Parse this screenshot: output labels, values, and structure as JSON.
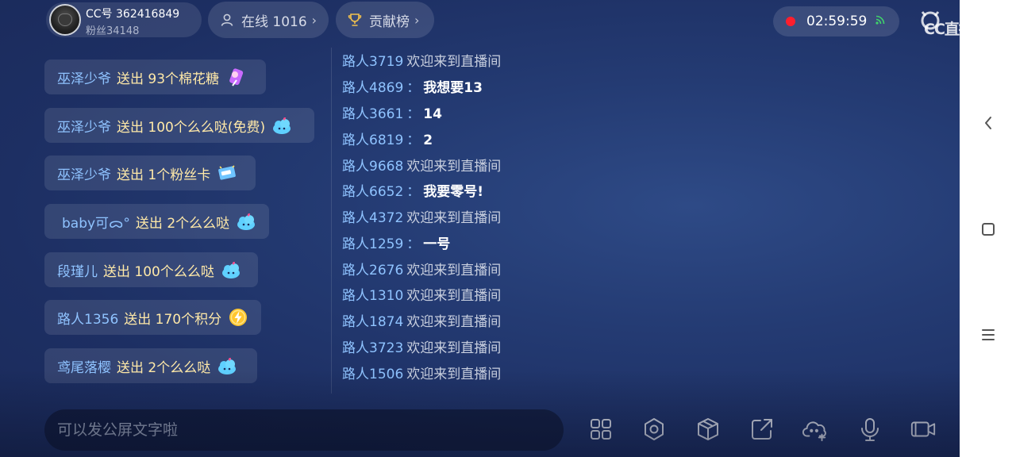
{
  "anchor": {
    "cc_id": "CC号 362416849",
    "fans": "粉丝34148"
  },
  "online": {
    "label": "在线 1016"
  },
  "rank": {
    "label": "贡献榜"
  },
  "timer": {
    "value": "02:59:59"
  },
  "gifts": [
    {
      "user": "巫泽少爷",
      "action": "送出 93个棉花糖",
      "icon": "cotton-candy-icon"
    },
    {
      "user": "巫泽少爷",
      "action": "送出 100个么么哒(免费)",
      "icon": "kiss-cloud-icon"
    },
    {
      "user": "巫泽少爷",
      "action": "送出 1个粉丝卡",
      "icon": "fan-card-icon"
    },
    {
      "user": "baby可ᯅ°",
      "action": "送出 2个么么哒",
      "icon": "kiss-cloud-icon"
    },
    {
      "user": "段瑾儿",
      "action": "送出 100个么么哒",
      "icon": "kiss-cloud-icon"
    },
    {
      "user": "路人1356",
      "action": "送出 170个积分",
      "icon": "lightning-coin-icon"
    },
    {
      "user": "鸢尾落樱",
      "action": "送出 2个么么哒",
      "icon": "kiss-cloud-icon"
    }
  ],
  "chat": [
    {
      "user": "路人3719",
      "system": "欢迎来到直播间"
    },
    {
      "user": "路人4869",
      "message": "我想要13"
    },
    {
      "user": "路人3661",
      "message": "14"
    },
    {
      "user": "路人6819",
      "message": "2"
    },
    {
      "user": "路人9668",
      "system": "欢迎来到直播间"
    },
    {
      "user": "路人6652",
      "message": "我要零号!"
    },
    {
      "user": "路人4372",
      "system": "欢迎来到直播间"
    },
    {
      "user": "路人1259",
      "message": "一号"
    },
    {
      "user": "路人2676",
      "system": "欢迎来到直播间"
    },
    {
      "user": "路人1310",
      "system": "欢迎来到直播间"
    },
    {
      "user": "路人1874",
      "system": "欢迎来到直播间"
    },
    {
      "user": "路人3723",
      "system": "欢迎来到直播间"
    },
    {
      "user": "路人1506",
      "system": "欢迎来到直播间"
    }
  ],
  "chat_colon": "：",
  "input": {
    "placeholder": "可以发公屏文字啦",
    "value": ""
  },
  "toolbar": [
    "apps-grid-icon",
    "settings-gear-icon",
    "box-icon",
    "share-icon",
    "cloud-add-icon",
    "microphone-icon",
    "camera-icon"
  ],
  "logo_text": "CC直播",
  "colors": {
    "username": "#8fc3ff",
    "gift_action": "#ffe9a8",
    "recording": "#ff1e2d"
  }
}
